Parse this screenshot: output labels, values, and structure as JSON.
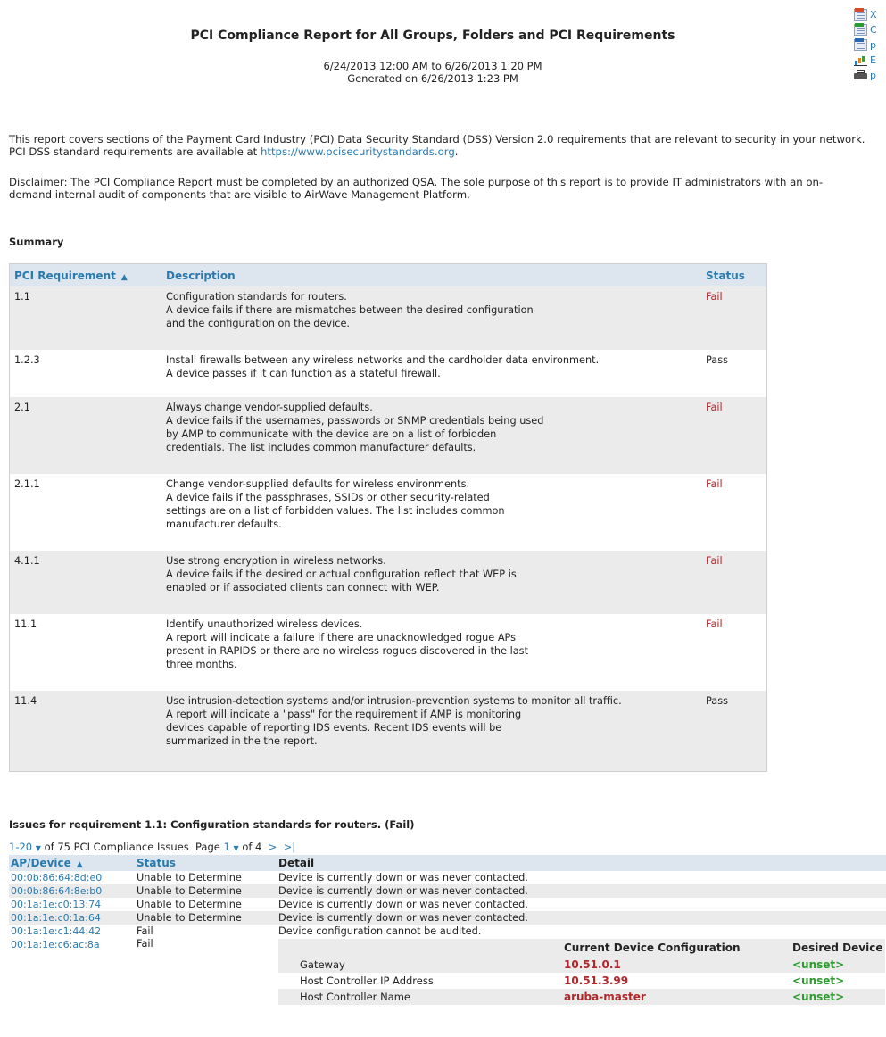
{
  "header": {
    "title": "PCI Compliance Report for All Groups, Folders and PCI Requirements",
    "date_range": "6/24/2013 12:00 AM to 6/26/2013 1:20 PM",
    "generated": "Generated on 6/26/2013 1:23 PM"
  },
  "export_links": [
    {
      "icon": "xml-icon",
      "label": "X"
    },
    {
      "icon": "csv-icon",
      "label": "C"
    },
    {
      "icon": "pdf-icon",
      "label": "p"
    },
    {
      "icon": "chart-icon",
      "label": "E"
    },
    {
      "icon": "print-icon",
      "label": "p"
    }
  ],
  "intro": {
    "text": "This report covers sections of the Payment Card Industry (PCI) Data Security Standard (DSS) Version 2.0 requirements that are relevant to security in your network. PCI DSS standard requirements are available at ",
    "link": "https://www.pcisecuritystandards.org",
    "after": ".",
    "disclaimer": "Disclaimer: The PCI Compliance Report must be completed by an authorized QSA. The sole purpose of this report is to provide IT administrators with an on-demand internal audit of components that are visible to AirWave Management Platform."
  },
  "summary": {
    "heading": "Summary",
    "columns": {
      "req": "PCI Requirement",
      "desc": "Description",
      "status": "Status"
    },
    "sort_arrow": "▲",
    "rows": [
      {
        "req": "1.1",
        "status": "Fail",
        "lines": [
          "Configuration standards for routers.",
          "A device fails if there are mismatches between the desired configuration",
          "and the configuration on the device."
        ]
      },
      {
        "req": "1.2.3",
        "status": "Pass",
        "lines": [
          "Install firewalls between any wireless networks and the cardholder data environment.",
          "A device passes if it can function as a stateful firewall."
        ]
      },
      {
        "req": "2.1",
        "status": "Fail",
        "lines": [
          "Always change vendor-supplied defaults.",
          "A device fails if the usernames, passwords or SNMP credentials being used",
          "by AMP to communicate with the device are on a list of forbidden",
          "credentials. The list includes common manufacturer defaults."
        ]
      },
      {
        "req": "2.1.1",
        "status": "Fail",
        "lines": [
          "Change vendor-supplied defaults for wireless environments.",
          "A device fails if the passphrases, SSIDs or other security-related",
          "settings are on a list of forbidden values. The list includes common",
          "manufacturer defaults."
        ]
      },
      {
        "req": "4.1.1",
        "status": "Fail",
        "lines": [
          "Use strong encryption in wireless networks.",
          "A device fails if the desired or actual configuration reflect that WEP is",
          "enabled or if associated clients can connect with WEP."
        ]
      },
      {
        "req": "11.1",
        "status": "Fail",
        "lines": [
          "Identify unauthorized wireless devices.",
          "A report will indicate a failure if there are unacknowledged rogue APs",
          "present in RAPIDS or there are no wireless rogues discovered in the last",
          "three months."
        ]
      },
      {
        "req": "11.4",
        "status": "Pass",
        "lines": [
          "Use intrusion-detection systems and/or intrusion-prevention systems to monitor all traffic.",
          "A report will indicate a \"pass\" for the requirement if AMP is monitoring",
          "devices capable of reporting IDS events. Recent IDS events will be",
          "summarized in the the report."
        ]
      }
    ]
  },
  "issues": {
    "heading": "Issues for requirement 1.1: Configuration standards for routers. (Fail)",
    "pager": {
      "range": "1-20",
      "total_text": "of 75 PCI Compliance Issues",
      "page_label": "Page",
      "page": "1",
      "of": "of 4",
      "next": ">",
      "last": ">|"
    },
    "columns": {
      "device": "AP/Device",
      "status": "Status",
      "detail": "Detail"
    },
    "rows": [
      {
        "device": "00:0b:86:64:8d:e0",
        "status": "Unable to Determine",
        "detail": "Device is currently down or was never contacted."
      },
      {
        "device": "00:0b:86:64:8e:b0",
        "status": "Unable to Determine",
        "detail": "Device is currently down or was never contacted."
      },
      {
        "device": "00:1a:1e:c0:13:74",
        "status": "Unable to Determine",
        "detail": "Device is currently down or was never contacted."
      },
      {
        "device": "00:1a:1e:c0:1a:64",
        "status": "Unable to Determine",
        "detail": "Device is currently down or was never contacted."
      },
      {
        "device": "00:1a:1e:c1:44:42",
        "status": "Fail",
        "detail": "Device configuration cannot be audited."
      }
    ],
    "last": {
      "device": "00:1a:1e:c6:ac:8a",
      "status": "Fail",
      "config_columns": {
        "current": "Current Device Configuration",
        "desired": "Desired Device"
      },
      "config_rows": [
        {
          "key": "Gateway",
          "current": "10.51.0.1",
          "desired": "<unset>"
        },
        {
          "key": "Host Controller IP Address",
          "current": "10.51.3.99",
          "desired": "<unset>"
        },
        {
          "key": "Host Controller Name",
          "current": "aruba-master",
          "desired": "<unset>"
        }
      ]
    }
  }
}
